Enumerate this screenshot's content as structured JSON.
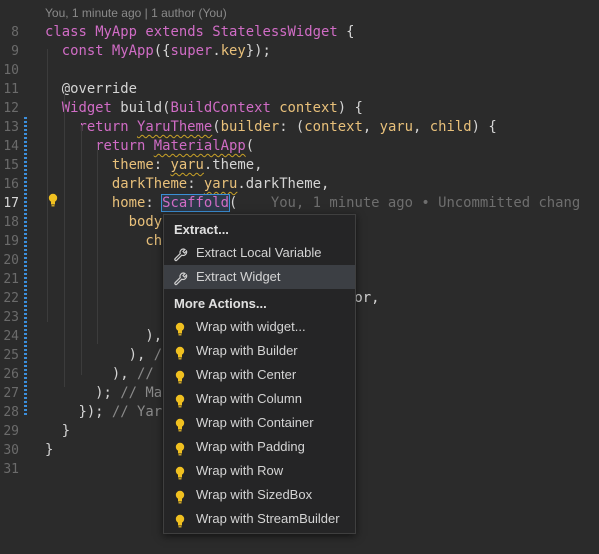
{
  "codelens": {
    "text": "You, 1 minute ago | 1 author (You)"
  },
  "lines": [
    {
      "n": "8",
      "seg": [
        [
          "kw",
          "class "
        ],
        [
          "ty",
          "MyApp "
        ],
        [
          "kw",
          "extends "
        ],
        [
          "ty",
          "StatelessWidget "
        ],
        [
          "plain",
          "{"
        ]
      ]
    },
    {
      "n": "9",
      "seg": [
        [
          "plain",
          "  "
        ],
        [
          "kw",
          "const "
        ],
        [
          "fn",
          "MyApp"
        ],
        [
          "plain",
          "({"
        ],
        [
          "kw",
          "super"
        ],
        [
          "plain",
          "."
        ],
        [
          "prop",
          "key"
        ],
        [
          "plain",
          "});"
        ]
      ]
    },
    {
      "n": "10",
      "seg": []
    },
    {
      "n": "11",
      "seg": [
        [
          "plain",
          "  @override"
        ]
      ]
    },
    {
      "n": "12",
      "seg": [
        [
          "plain",
          "  "
        ],
        [
          "ty",
          "Widget "
        ],
        [
          "plain",
          "build("
        ],
        [
          "ty",
          "BuildContext "
        ],
        [
          "param",
          "context"
        ],
        [
          "plain",
          ") {"
        ]
      ]
    },
    {
      "n": "13",
      "seg": [
        [
          "plain",
          "    "
        ],
        [
          "kw",
          "return "
        ],
        [
          "fn",
          "YaruTheme"
        ],
        [
          "plain",
          "("
        ],
        [
          "prop",
          "builder"
        ],
        [
          "plain",
          ": ("
        ],
        [
          "param",
          "context"
        ],
        [
          "plain",
          ", "
        ],
        [
          "param",
          "yaru"
        ],
        [
          "plain",
          ", "
        ],
        [
          "param",
          "child"
        ],
        [
          "plain",
          ") {"
        ]
      ]
    },
    {
      "n": "14",
      "seg": [
        [
          "plain",
          "      "
        ],
        [
          "kw",
          "return "
        ],
        [
          "fn",
          "MaterialApp"
        ],
        [
          "plain",
          "("
        ]
      ]
    },
    {
      "n": "15",
      "seg": [
        [
          "plain",
          "        "
        ],
        [
          "prop",
          "theme"
        ],
        [
          "plain",
          ": "
        ],
        [
          "param",
          "yaru"
        ],
        [
          "plain",
          ".theme,"
        ]
      ]
    },
    {
      "n": "16",
      "seg": [
        [
          "plain",
          "        "
        ],
        [
          "prop",
          "darkTheme"
        ],
        [
          "plain",
          ": "
        ],
        [
          "param",
          "yaru"
        ],
        [
          "plain",
          ".darkTheme,"
        ]
      ]
    },
    {
      "n": "17",
      "seg": [
        [
          "plain",
          "        "
        ],
        [
          "prop",
          "home"
        ],
        [
          "plain",
          ": "
        ],
        [
          "fn",
          "Scaffold"
        ],
        [
          "plain",
          "("
        ]
      ]
    },
    {
      "n": "18",
      "seg": [
        [
          "plain",
          "          "
        ],
        [
          "prop",
          "body"
        ]
      ]
    },
    {
      "n": "19",
      "seg": [
        [
          "plain",
          "            "
        ],
        [
          "prop",
          "ch"
        ]
      ]
    },
    {
      "n": "20",
      "seg": []
    },
    {
      "n": "21",
      "seg": []
    },
    {
      "n": "22",
      "seg": [
        [
          "plain",
          "                      "
        ],
        [
          "plain",
          "ext).primaryColor,"
        ]
      ]
    },
    {
      "n": "23",
      "seg": []
    },
    {
      "n": "24",
      "seg": [
        [
          "plain",
          "            ),"
        ]
      ]
    },
    {
      "n": "25",
      "seg": [
        [
          "plain",
          "          ), "
        ],
        [
          "cm",
          "/"
        ]
      ]
    },
    {
      "n": "26",
      "seg": [
        [
          "plain",
          "        ), "
        ],
        [
          "cm",
          "//"
        ]
      ]
    },
    {
      "n": "27",
      "seg": [
        [
          "plain",
          "      ); "
        ],
        [
          "cm",
          "// Ma"
        ]
      ]
    },
    {
      "n": "28",
      "seg": [
        [
          "plain",
          "    }); "
        ],
        [
          "cm",
          "// Yar"
        ]
      ]
    },
    {
      "n": "29",
      "seg": [
        [
          "plain",
          "  }"
        ]
      ]
    },
    {
      "n": "30",
      "seg": [
        [
          "plain",
          "}"
        ]
      ]
    },
    {
      "n": "31",
      "seg": []
    }
  ],
  "ghost_blame": "You, 1 minute ago • Uncommitted chang",
  "menu": {
    "section_extract": "Extract...",
    "extract_items": [
      {
        "label": "Extract Local Variable",
        "icon": "wrench-icon"
      },
      {
        "label": "Extract Widget",
        "icon": "wrench-icon",
        "selected": true
      }
    ],
    "section_more": "More Actions...",
    "more_items": [
      {
        "label": "Wrap with widget...",
        "icon": "lightbulb-icon"
      },
      {
        "label": "Wrap with Builder",
        "icon": "lightbulb-icon"
      },
      {
        "label": "Wrap with Center",
        "icon": "lightbulb-icon"
      },
      {
        "label": "Wrap with Column",
        "icon": "lightbulb-icon"
      },
      {
        "label": "Wrap with Container",
        "icon": "lightbulb-icon"
      },
      {
        "label": "Wrap with Padding",
        "icon": "lightbulb-icon"
      },
      {
        "label": "Wrap with Row",
        "icon": "lightbulb-icon"
      },
      {
        "label": "Wrap with SizedBox",
        "icon": "lightbulb-icon"
      },
      {
        "label": "Wrap with StreamBuilder",
        "icon": "lightbulb-icon"
      }
    ]
  },
  "colors": {
    "background": "#2b2b2b",
    "keyword": "#d06cc5",
    "property": "#e8c07a",
    "bulb": "#f0c020",
    "change_bar": "#3c8fdc"
  }
}
